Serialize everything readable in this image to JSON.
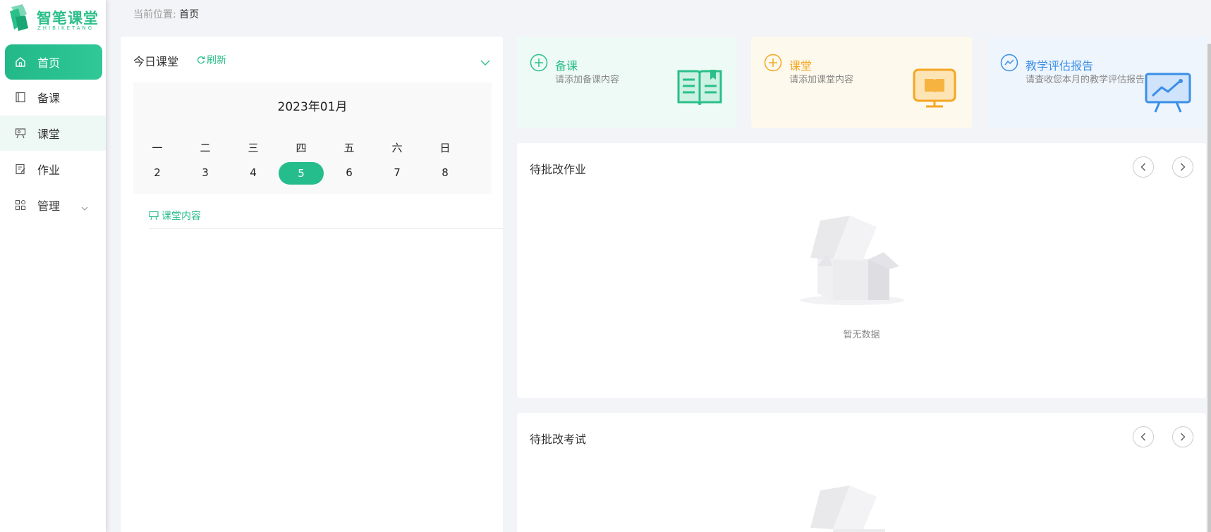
{
  "logo": {
    "name": "智笔课堂",
    "sub": "ZHIBIKETANG"
  },
  "sidebar": {
    "items": [
      {
        "label": "首页",
        "icon": "home-icon"
      },
      {
        "label": "备课",
        "icon": "notebook-icon"
      },
      {
        "label": "课堂",
        "icon": "presentation-icon"
      },
      {
        "label": "作业",
        "icon": "edit-doc-icon"
      },
      {
        "label": "管理",
        "icon": "grid-icon"
      }
    ]
  },
  "breadcrumb": {
    "label": "当前位置:",
    "current": "首页"
  },
  "today": {
    "title": "今日课堂",
    "refresh": "刷新",
    "month": "2023年01月",
    "weekdays": [
      "一",
      "二",
      "三",
      "四",
      "五",
      "六",
      "日"
    ],
    "days": [
      "2",
      "3",
      "4",
      "5",
      "6",
      "7",
      "8"
    ],
    "selected_day": "5",
    "class_content": "课堂内容"
  },
  "quick": [
    {
      "title": "备课",
      "sub": "请添加备课内容",
      "color": "#2bbf8a"
    },
    {
      "title": "课堂",
      "sub": "请添加课堂内容",
      "color": "#f5a623"
    },
    {
      "title": "教学评估报告",
      "sub": "请查收您本月的教学评估报告",
      "color": "#3a8ee6"
    }
  ],
  "panels": {
    "homework": {
      "title": "待批改作业",
      "empty": "暂无数据"
    },
    "exam": {
      "title": "待批改考试"
    }
  },
  "colors": {
    "accent": "#2bbf8a",
    "bg": "#f3f4f7"
  }
}
